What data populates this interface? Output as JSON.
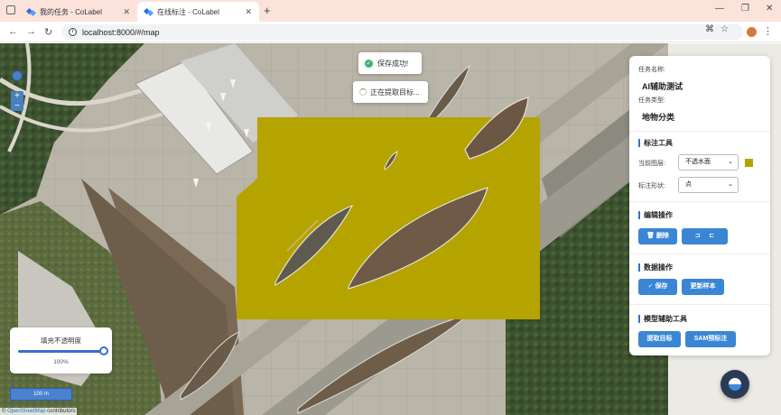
{
  "browser": {
    "tabs": [
      {
        "title": "我的任务 - CoLabel",
        "active": false
      },
      {
        "title": "在线标注 - CoLabel",
        "active": true
      }
    ],
    "url": "localhost:8000/#/map"
  },
  "map": {
    "zoom_in": "+",
    "zoom_out": "−",
    "toasts": {
      "success": "保存成功!",
      "loading": "正在提取目标..."
    },
    "opacity_panel": {
      "label": "填充不透明度",
      "value": 1.0,
      "value_text": "100%"
    },
    "scale_text": "100 m",
    "attribution": {
      "prefix": "© ",
      "link": "OpenStreetMap",
      "suffix": " contributors"
    },
    "overlay_color": "#b5a300"
  },
  "panel": {
    "task_name_label": "任务名称:",
    "task_name": "AI辅助测试",
    "task_type_label": "任务类型:",
    "task_type": "地物分类",
    "annotation_tools": {
      "title": "标注工具",
      "layer_label": "当前图层:",
      "layer_value": "不透水面",
      "layer_color": "#b5a300",
      "shape_label": "标注形状:",
      "shape_value": "点"
    },
    "edit_ops": {
      "title": "编辑操作",
      "delete_label": "删除",
      "undo_icon": "⊐",
      "redo_icon": "⊏"
    },
    "data_ops": {
      "title": "数据操作",
      "save_label": "保存",
      "update_sample_label": "更新样本"
    },
    "model_tools": {
      "title": "模型辅助工具",
      "extract_label": "提取目标",
      "sam_label": "SAM预标注"
    }
  }
}
